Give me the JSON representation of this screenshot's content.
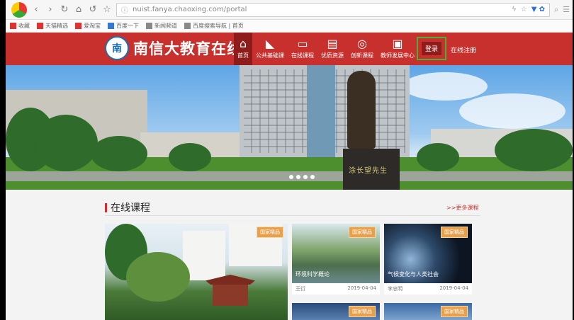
{
  "browser": {
    "url": "nuist.fanya.chaoxing.com/portal",
    "bookmarks": [
      "收藏",
      "天猫精选",
      "爱淘宝",
      "百度一下",
      "新闻频道",
      "百度搜索导航 | 首页"
    ]
  },
  "site": {
    "name": "南信大教育在线",
    "emblem": "南",
    "menu": [
      {
        "label": "首页",
        "icon": "home-icon",
        "glyph": "⌂",
        "active": true
      },
      {
        "label": "公共基础课",
        "icon": "book-icon",
        "glyph": "◣",
        "active": false
      },
      {
        "label": "在线课程",
        "icon": "monitor-icon",
        "glyph": "▭",
        "active": false
      },
      {
        "label": "优质资源",
        "icon": "folder-icon",
        "glyph": "▤",
        "active": false
      },
      {
        "label": "创新课程",
        "icon": "search-icon",
        "glyph": "◎",
        "active": false
      },
      {
        "label": "教师发展中心",
        "icon": "briefcase-icon",
        "glyph": "▣",
        "active": false
      }
    ],
    "login": "登录",
    "register": "在线注册"
  },
  "banner": {
    "plaque": "涂长望先生"
  },
  "courses": {
    "title": "在线课程",
    "more": ">>更多课程",
    "badge": "国家精品",
    "cards": [
      {
        "title": "环境科学概论",
        "teacher": "王衍",
        "date": "2019-04-04"
      },
      {
        "title": "气候变化与人类社会",
        "teacher": "李忠明",
        "date": "2019-04-04"
      }
    ]
  },
  "colors": {
    "brand": "#c8302e",
    "active": "#8e1c1a",
    "highlight": "#4caf3a"
  }
}
